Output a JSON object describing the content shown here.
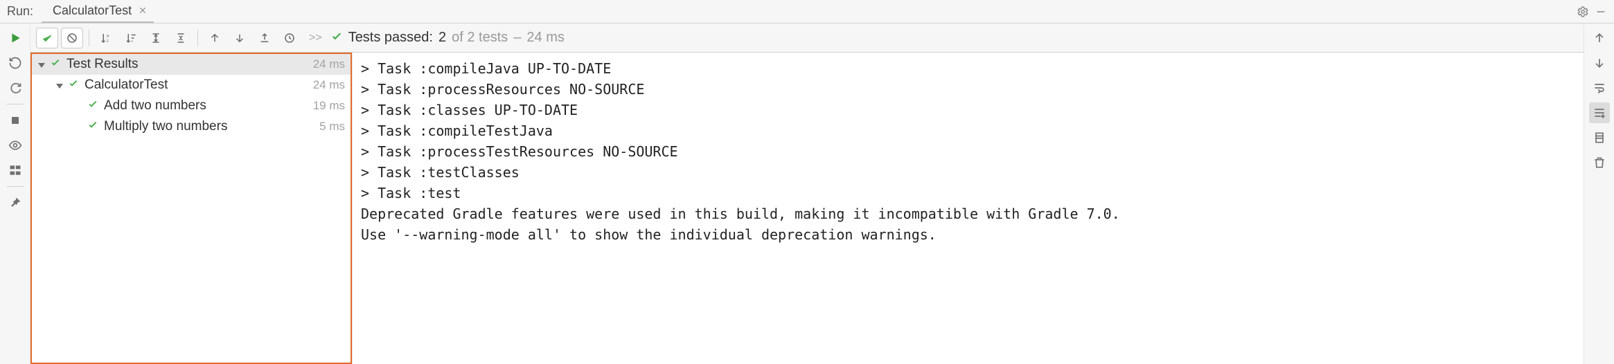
{
  "header": {
    "run_label": "Run:",
    "tab": {
      "name": "CalculatorTest"
    }
  },
  "toolbar": {
    "chevrons": ">>",
    "status_prefix": "Tests passed:",
    "passed_count": "2",
    "of_label": "of 2 tests",
    "dash": "–",
    "total_time": "24 ms"
  },
  "tree": {
    "root": {
      "label": "Test Results",
      "time": "24 ms"
    },
    "suite": {
      "label": "CalculatorTest",
      "time": "24 ms"
    },
    "tests": [
      {
        "label": "Add two numbers",
        "time": "19 ms"
      },
      {
        "label": "Multiply two numbers",
        "time": "5 ms"
      }
    ]
  },
  "console": {
    "lines": [
      "> Task :compileJava UP-TO-DATE",
      "> Task :processResources NO-SOURCE",
      "> Task :classes UP-TO-DATE",
      "> Task :compileTestJava",
      "> Task :processTestResources NO-SOURCE",
      "> Task :testClasses",
      "> Task :test",
      "Deprecated Gradle features were used in this build, making it incompatible with Gradle 7.0.",
      "Use '--warning-mode all' to show the individual deprecation warnings."
    ]
  }
}
